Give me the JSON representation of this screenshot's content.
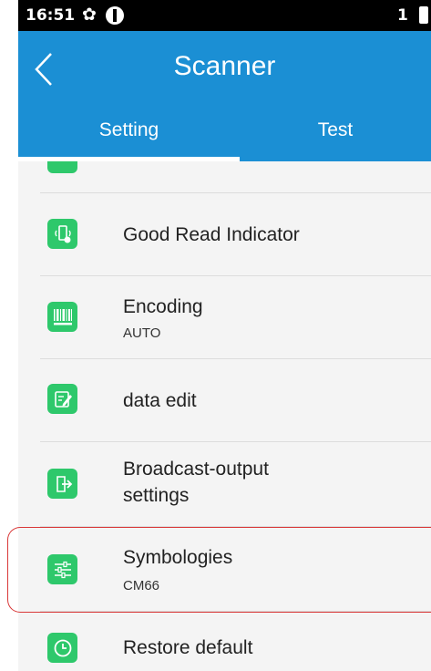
{
  "status_bar": {
    "time": "16:51",
    "sim": "1"
  },
  "app_bar": {
    "title": "Scanner"
  },
  "tabs": [
    {
      "label": "Setting"
    },
    {
      "label": "Test"
    }
  ],
  "items": [
    {
      "label": "Good Read Indicator",
      "icon": "good-read-indicator-icon"
    },
    {
      "label": "Encoding",
      "sub": "AUTO",
      "icon": "barcode-icon"
    },
    {
      "label": "data edit",
      "icon": "edit-icon"
    },
    {
      "label": "Broadcast-output settings",
      "line1": "Broadcast-output",
      "line2": "settings",
      "icon": "export-icon"
    },
    {
      "label": "Symbologies",
      "sub": "CM66",
      "icon": "sliders-icon"
    },
    {
      "label": "Restore default",
      "icon": "clock-icon"
    }
  ],
  "colors": {
    "primary": "#1b8fd4",
    "icon_green": "#2ec86b",
    "highlight": "#d93838",
    "list_bg": "#f4f4f4"
  }
}
